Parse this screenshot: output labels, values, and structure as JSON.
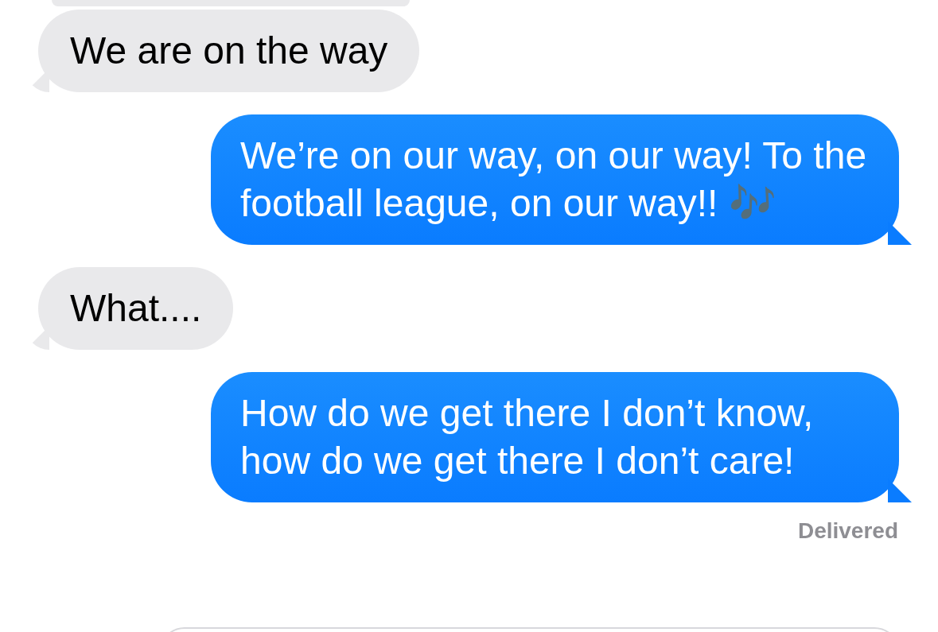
{
  "messages": [
    {
      "kind": "received",
      "text": "We are on the way"
    },
    {
      "kind": "sent",
      "text": "We’re on our way, on our way! To the football league, on our way!! 🎶"
    },
    {
      "kind": "received",
      "text": "What...."
    },
    {
      "kind": "sent",
      "text": "How do we get there I don’t know, how do we get there I don’t care!"
    }
  ],
  "status": "Delivered"
}
